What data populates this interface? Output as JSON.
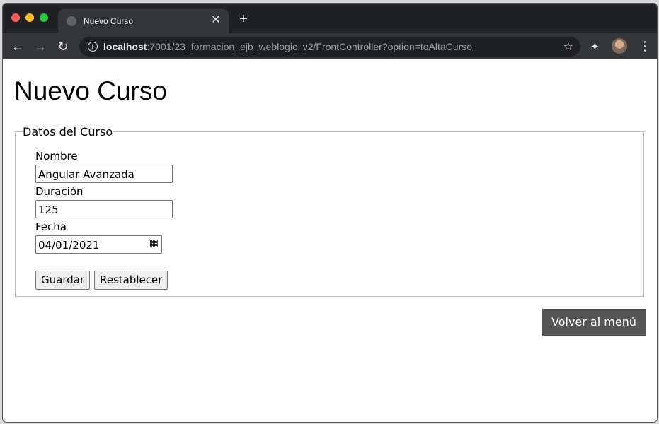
{
  "browser": {
    "tab_title": "Nuevo Curso",
    "tab_close": "✕",
    "new_tab": "+",
    "url_host": "localhost",
    "url_path": ":7001/23_formacion_ejb_weblogic_v2/FrontController?option=toAltaCurso"
  },
  "page": {
    "title": "Nuevo Curso",
    "fieldset_legend": "Datos del Curso",
    "fields": {
      "nombre_label": "Nombre",
      "nombre_value": "Angular Avanzada",
      "duracion_label": "Duración",
      "duracion_value": "125",
      "fecha_label": "Fecha",
      "fecha_value": "04/01/2021"
    },
    "buttons": {
      "save": "Guardar",
      "reset": "Restablecer",
      "back_menu": "Volver al menú"
    }
  },
  "icons": [
    "back-arrow-icon",
    "forward-arrow-icon",
    "reload-icon",
    "info-icon",
    "star-icon",
    "extensions-icon",
    "kebab-menu-icon",
    "calendar-icon"
  ]
}
